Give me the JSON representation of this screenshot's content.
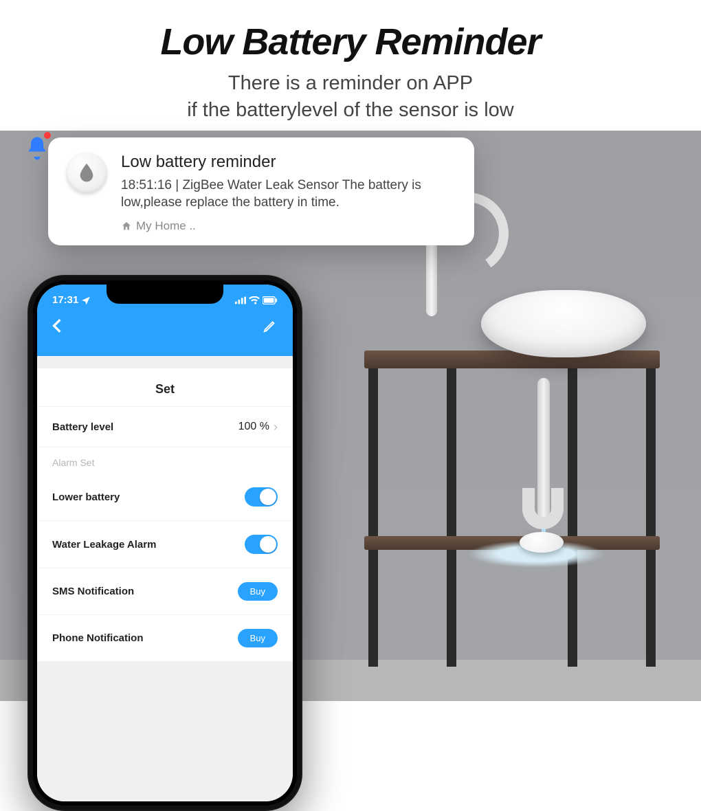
{
  "hero": {
    "title": "Low Battery Reminder",
    "subtitle_line1": "There is a reminder on APP",
    "subtitle_line2": "if the batterylevel of the sensor is low"
  },
  "notification": {
    "title": "Low battery reminder",
    "body": "18:51:16 | ZigBee Water Leak Sensor The battery is low,please replace the battery in time.",
    "home_label": "My Home .."
  },
  "phone": {
    "status_time": "17:31",
    "screen_title": "Set",
    "battery_row": {
      "label": "Battery level",
      "value": "100 %"
    },
    "section_label": "Alarm Set",
    "rows": [
      {
        "label": "Lower battery",
        "type": "toggle",
        "on": true
      },
      {
        "label": "Water Leakage Alarm",
        "type": "toggle",
        "on": true
      },
      {
        "label": "SMS Notification",
        "type": "buy",
        "action": "Buy"
      },
      {
        "label": "Phone Notification",
        "type": "buy",
        "action": "Buy"
      }
    ]
  }
}
